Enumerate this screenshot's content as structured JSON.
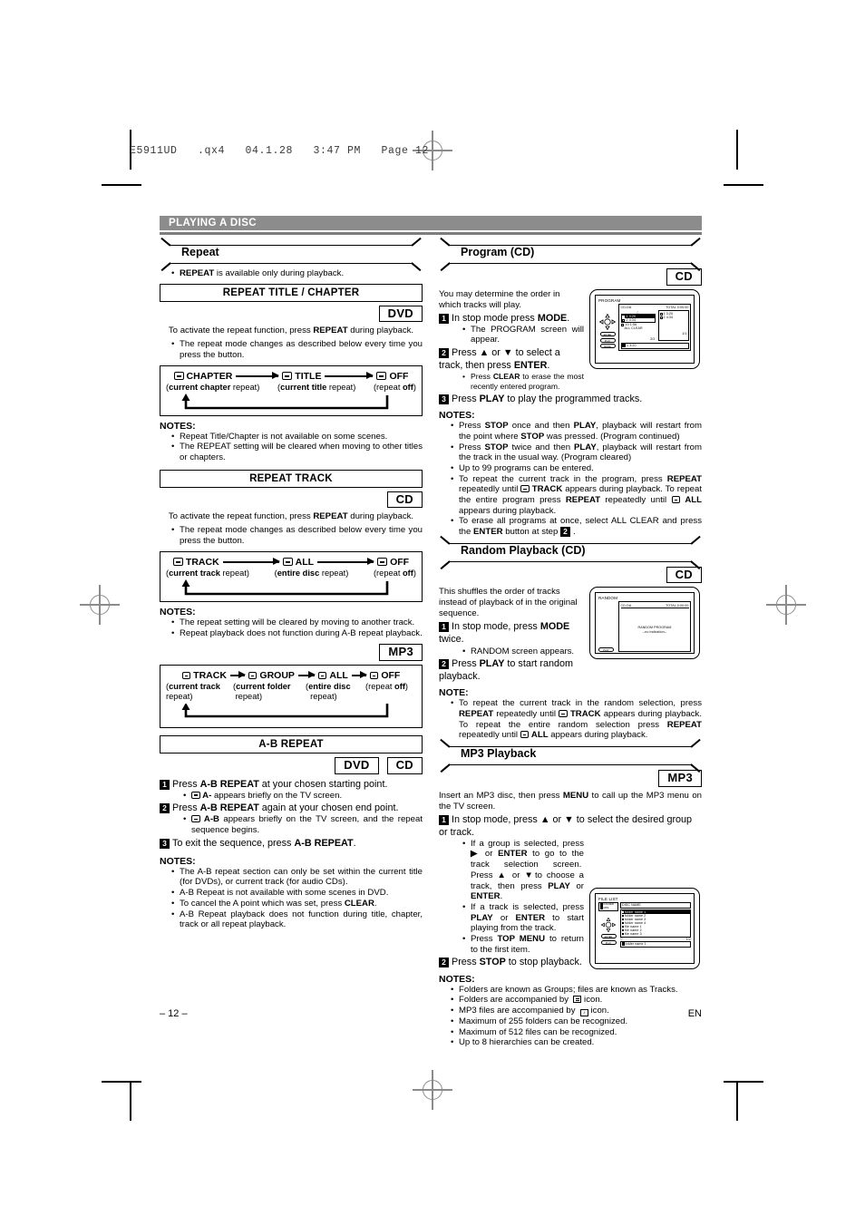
{
  "fileinfo": "E5911UD   .qx4   04.1.28   3:47 PM   Page 12",
  "banner": {
    "title": "PLAYING A DISC"
  },
  "footer": {
    "page": "– 12 –",
    "lang": "EN"
  },
  "left": {
    "repeat": {
      "heading": "Repeat",
      "intro_bullet": "REPEAT is available only during playback.",
      "intro_bullet_bold": "REPEAT",
      "title_chapter": {
        "box_title": "REPEAT TITLE / CHAPTER",
        "badge": "DVD",
        "lead": "To activate the repeat function, press REPEAT during playback.",
        "bullet": "The repeat mode changes as described below every time you press the button.",
        "flow": [
          {
            "icon": "repeat-icon",
            "label": "CHAPTER",
            "sub_bold": "current chapter",
            "sub_rest": "repeat",
            "sub_prefix": "(",
            "sub_suffix": ")"
          },
          {
            "icon": "repeat-icon",
            "label": "TITLE",
            "sub_bold": "current title",
            "sub_rest": "repeat",
            "sub_prefix": "(",
            "sub_suffix": ")"
          },
          {
            "icon": "repeat-icon",
            "label": "OFF",
            "sub_bold": "off",
            "sub_rest": "repeat",
            "sub_prefix": "(",
            "sub_suffix": ")"
          }
        ],
        "notes_title": "NOTES:",
        "notes": [
          "Repeat Title/Chapter is not available on some scenes.",
          "The REPEAT setting will be cleared when moving to other titles or chapters."
        ]
      },
      "track": {
        "box_title": "REPEAT TRACK",
        "badge": "CD",
        "lead": "To activate the repeat function, press REPEAT during playback.",
        "bullet": "The repeat mode changes as described below every time you press the button.",
        "flow": [
          {
            "label": "TRACK",
            "sub_bold": "current track",
            "sub_rest": "repeat"
          },
          {
            "label": "ALL",
            "sub_bold": "entire disc",
            "sub_rest": "repeat"
          },
          {
            "label": "OFF",
            "sub_bold": "off",
            "sub_rest": "repeat"
          }
        ],
        "notes_title": "NOTES:",
        "notes": [
          "The repeat setting will be cleared by moving to another track.",
          "Repeat playback does not function during A-B repeat playback."
        ]
      },
      "mp3": {
        "badge": "MP3",
        "flow": [
          {
            "label": "TRACK",
            "sub_bold": "current track",
            "sub_rest": "repeat"
          },
          {
            "label": "GROUP",
            "sub_bold": "current folder",
            "sub_rest": "repeat"
          },
          {
            "label": "ALL",
            "sub_bold": "entire disc",
            "sub_rest": "repeat"
          },
          {
            "label": "OFF",
            "sub_bold": "off",
            "sub_rest": "repeat"
          }
        ]
      },
      "ab": {
        "box_title": "A-B REPEAT",
        "badges": [
          "DVD",
          "CD"
        ],
        "steps": [
          {
            "num": "1",
            "text": "Press A-B REPEAT at your chosen starting point.",
            "subs": [
              "A- appears briefly on the TV screen."
            ]
          },
          {
            "num": "2",
            "text": "Press A-B REPEAT again at your chosen end point.",
            "subs": [
              "A-B appears briefly on the TV screen, and the repeat sequence begins."
            ]
          },
          {
            "num": "3",
            "text": "To exit the sequence, press A-B REPEAT.",
            "subs": []
          }
        ],
        "notes_title": "NOTES:",
        "notes": [
          "The A-B repeat section can only be set within the current title (for DVDs), or current track (for audio CDs).",
          "A-B Repeat is not available with some scenes in DVD.",
          "To cancel the A point which was set, press CLEAR.",
          "A-B Repeat playback does not function during title, chapter, track or all repeat playback."
        ]
      }
    }
  },
  "right": {
    "program": {
      "heading": "Program (CD)",
      "badge": "CD",
      "lead": "You may determine the order in which tracks will play.",
      "steps": [
        {
          "num": "1",
          "text": "In stop mode press MODE.",
          "subs": [
            "The PROGRAM screen will appear."
          ]
        },
        {
          "num": "2",
          "text": "Press ▲ or ▼ to select a track, then press ENTER.",
          "subs": [
            "Press CLEAR to erase the most recently entered program."
          ]
        },
        {
          "num": "3",
          "text": "Press PLAY to play the programmed tracks.",
          "subs": []
        }
      ],
      "osd": {
        "title": "PROGRAM",
        "disc_type": "CD-DA",
        "total": "TOTAL 0:00:00",
        "tracks": [
          "1  3:20",
          "2  4:34",
          "10 1:56",
          "ALL CLEAR"
        ],
        "program_list": [
          "1   3:20",
          "2   4:34"
        ],
        "page_left": "2/2",
        "page_right": "1/1",
        "bottom": "1   3:20",
        "buttons": [
          "ENTER",
          "PLAY",
          "MODE"
        ]
      },
      "notes_title": "NOTES:",
      "notes": [
        "Press STOP once and then PLAY, playback will restart from the point where STOP was pressed. (Program continued)",
        "Press STOP twice and then PLAY, playback will restart from the track in the usual way. (Program cleared)",
        "Up to 99 programs can be entered.",
        "To repeat the current track in the program, press REPEAT repeatedly until TRACK appears during playback. To repeat the entire program press REPEAT repeatedly until ALL appears during playback.",
        "To erase all programs at once, select ALL CLEAR and press the ENTER button at step 2."
      ]
    },
    "random": {
      "heading": "Random Playback (CD)",
      "badge": "CD",
      "lead": "This shuffles the order of tracks instead of playback of in the original sequence.",
      "steps": [
        {
          "num": "1",
          "text": "In stop mode, press MODE twice.",
          "subs": [
            "RANDOM screen appears."
          ]
        },
        {
          "num": "2",
          "text": "Press PLAY to start random playback.",
          "subs": []
        }
      ],
      "osd": {
        "title": "RANDOM",
        "disc_type": "CD-DA",
        "total": "TOTAL 0:00:00",
        "center_line1": "RANDOM PROGRAM",
        "center_line2": "--no indication--",
        "buttons": [
          "PLAY"
        ]
      },
      "notes_title": "NOTE:",
      "notes": [
        "To repeat the current track in the random selection, press REPEAT repeatedly until TRACK appears during playback. To repeat the entire random selection press REPEAT repeatedly until ALL appears during playback."
      ]
    },
    "mp3": {
      "heading": "MP3 Playback",
      "badge": "MP3",
      "lead": "Insert an MP3 disc, then press MENU to call up the MP3 menu on the TV screen.",
      "steps": [
        {
          "num": "1",
          "text": "In stop mode, press ▲ or ▼ to select the desired group or track.",
          "subs": [
            "If a group is selected, press ▶ or ENTER to go to the track selection screen.  Press ▲ or ▼to choose a track, then press PLAY or ENTER.",
            "If a track is selected, press PLAY or ENTER to start playing from the track.",
            "Press TOP MENU to return to the first item."
          ]
        },
        {
          "num": "2",
          "text": "Press STOP to stop playback.",
          "subs": []
        }
      ],
      "osd": {
        "title": "FILE LIST",
        "side_label1": "FOLDER",
        "side_label2": "MP3",
        "disc_name": "DISC NAME",
        "rows": [
          "folder name 1",
          "folder name 2",
          "folder name 3",
          "folder name 4",
          "file name 1",
          "file name 2",
          "file name 3"
        ],
        "page": "1/2",
        "bottom": "folder name 1",
        "buttons": [
          "ENTER",
          "PLAY"
        ]
      },
      "notes_title": "NOTES:",
      "notes": [
        "Folders are known as Groups; files are known as Tracks.",
        "Folders are accompanied by   icon.",
        "MP3 files are accompanied by   icon.",
        "Maximum of 255 folders can be recognized.",
        "Maximum of 512 files can be recognized.",
        "Up to 8 hierarchies can be created."
      ]
    }
  }
}
